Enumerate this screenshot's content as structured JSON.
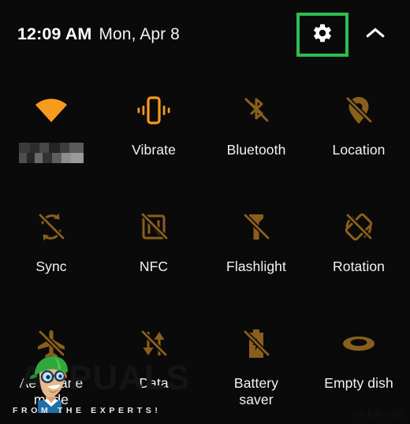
{
  "panel": {
    "background_color": "#0a0a0a",
    "accent_on_color": "#f79a1e",
    "accent_off_color": "#8a5f1c",
    "highlight_color": "#2dbe4e",
    "text_color": "#f3f3f3"
  },
  "header": {
    "time": "12:09 AM",
    "date": "Mon, Apr 8",
    "settings_icon": "gear-icon",
    "settings_label": "Settings",
    "collapse_icon": "chevron-up-icon",
    "collapse_label": "Collapse"
  },
  "tiles": [
    {
      "label": "",
      "icon": "wifi-icon",
      "state": "on",
      "censored": true,
      "multiline": false
    },
    {
      "label": "Vibrate",
      "icon": "vibrate-icon",
      "state": "on",
      "censored": false,
      "multiline": false
    },
    {
      "label": "Bluetooth",
      "icon": "bluetooth-off-icon",
      "state": "off",
      "censored": false,
      "multiline": false
    },
    {
      "label": "Location",
      "icon": "location-off-icon",
      "state": "off",
      "censored": false,
      "multiline": false
    },
    {
      "label": "Sync",
      "icon": "sync-off-icon",
      "state": "off",
      "censored": false,
      "multiline": false
    },
    {
      "label": "NFC",
      "icon": "nfc-off-icon",
      "state": "off",
      "censored": false,
      "multiline": false
    },
    {
      "label": "Flashlight",
      "icon": "flashlight-off-icon",
      "state": "off",
      "censored": false,
      "multiline": false
    },
    {
      "label": "Rotation",
      "icon": "rotation-off-icon",
      "state": "off",
      "censored": false,
      "multiline": false
    },
    {
      "label": "Aeroplane\nmode",
      "icon": "airplane-off-icon",
      "state": "off",
      "censored": false,
      "multiline": true
    },
    {
      "label": "Data",
      "icon": "data-off-icon",
      "state": "off",
      "censored": false,
      "multiline": false
    },
    {
      "label": "Battery\nsaver",
      "icon": "battery-saver-off-icon",
      "state": "off",
      "censored": false,
      "multiline": true
    },
    {
      "label": "Empty dish",
      "icon": "empty-dish-icon",
      "state": "off",
      "censored": false,
      "multiline": false
    }
  ],
  "watermark": {
    "brand": "APPUALS",
    "tagline": "FROM THE EXPERTS!",
    "mascot": "mascot-character"
  },
  "corner_credit": "ws.kdn.com"
}
